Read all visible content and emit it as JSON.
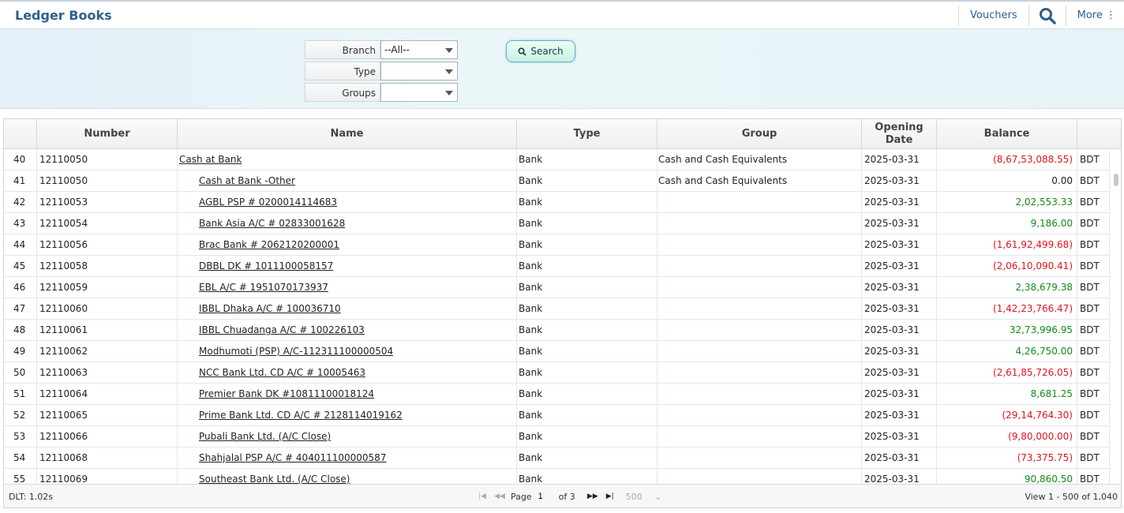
{
  "app": {
    "title": "Ledger Books"
  },
  "nav": {
    "vouchers": "Vouchers",
    "more": "More ⋮"
  },
  "filters": {
    "branch": {
      "label": "Branch",
      "value": "--All--"
    },
    "type": {
      "label": "Type",
      "value": ""
    },
    "groups": {
      "label": "Groups",
      "value": ""
    },
    "search_label": "Search"
  },
  "table": {
    "columns": {
      "number": "Number",
      "name": "Name",
      "type": "Type",
      "group": "Group",
      "opening_date": "Opening Date",
      "balance": "Balance"
    },
    "rows": [
      {
        "idx": "40",
        "number": "12110050",
        "name": "Cash at Bank",
        "indent": false,
        "type": "Bank",
        "group": "Cash and Cash Equivalents",
        "date": "2025-03-31",
        "balance": "(8,67,53,088.55)",
        "sign": "neg",
        "currency": "BDT"
      },
      {
        "idx": "41",
        "number": "12110050",
        "name": "Cash at Bank -Other",
        "indent": true,
        "type": "Bank",
        "group": "Cash and Cash Equivalents",
        "date": "2025-03-31",
        "balance": "0.00",
        "sign": "zero",
        "currency": "BDT"
      },
      {
        "idx": "42",
        "number": "12110053",
        "name": "AGBL PSP # 0200014114683",
        "indent": true,
        "type": "Bank",
        "group": "",
        "date": "2025-03-31",
        "balance": "2,02,553.33",
        "sign": "pos",
        "currency": "BDT"
      },
      {
        "idx": "43",
        "number": "12110054",
        "name": "Bank Asia A/C # 02833001628",
        "indent": true,
        "type": "Bank",
        "group": "",
        "date": "2025-03-31",
        "balance": "9,186.00",
        "sign": "pos",
        "currency": "BDT"
      },
      {
        "idx": "44",
        "number": "12110056",
        "name": "Brac Bank # 2062120200001",
        "indent": true,
        "type": "Bank",
        "group": "",
        "date": "2025-03-31",
        "balance": "(1,61,92,499.68)",
        "sign": "neg",
        "currency": "BDT"
      },
      {
        "idx": "45",
        "number": "12110058",
        "name": "DBBL DK # 1011100058157",
        "indent": true,
        "type": "Bank",
        "group": "",
        "date": "2025-03-31",
        "balance": "(2,06,10,090.41)",
        "sign": "neg",
        "currency": "BDT"
      },
      {
        "idx": "46",
        "number": "12110059",
        "name": "EBL A/C # 1951070173937",
        "indent": true,
        "type": "Bank",
        "group": "",
        "date": "2025-03-31",
        "balance": "2,38,679.38",
        "sign": "pos",
        "currency": "BDT"
      },
      {
        "idx": "47",
        "number": "12110060",
        "name": "IBBL Dhaka A/C # 100036710",
        "indent": true,
        "type": "Bank",
        "group": "",
        "date": "2025-03-31",
        "balance": "(1,42,23,766.47)",
        "sign": "neg",
        "currency": "BDT"
      },
      {
        "idx": "48",
        "number": "12110061",
        "name": "IBBL Chuadanga A/C # 100226103",
        "indent": true,
        "type": "Bank",
        "group": "",
        "date": "2025-03-31",
        "balance": "32,73,996.95",
        "sign": "pos",
        "currency": "BDT"
      },
      {
        "idx": "49",
        "number": "12110062",
        "name": "Modhumoti (PSP) A/C-112311100000504",
        "indent": true,
        "type": "Bank",
        "group": "",
        "date": "2025-03-31",
        "balance": "4,26,750.00",
        "sign": "pos",
        "currency": "BDT"
      },
      {
        "idx": "50",
        "number": "12110063",
        "name": "NCC Bank Ltd. CD A/C # 10005463",
        "indent": true,
        "type": "Bank",
        "group": "",
        "date": "2025-03-31",
        "balance": "(2,61,85,726.05)",
        "sign": "neg",
        "currency": "BDT"
      },
      {
        "idx": "51",
        "number": "12110064",
        "name": "Premier Bank DK #10811100018124",
        "indent": true,
        "type": "Bank",
        "group": "",
        "date": "2025-03-31",
        "balance": "8,681.25",
        "sign": "pos",
        "currency": "BDT"
      },
      {
        "idx": "52",
        "number": "12110065",
        "name": "Prime Bank Ltd. CD A/C # 2128114019162",
        "indent": true,
        "type": "Bank",
        "group": "",
        "date": "2025-03-31",
        "balance": "(29,14,764.30)",
        "sign": "neg",
        "currency": "BDT"
      },
      {
        "idx": "53",
        "number": "12110066",
        "name": "Pubali Bank Ltd. (A/C Close)",
        "indent": true,
        "type": "Bank",
        "group": "",
        "date": "2025-03-31",
        "balance": "(9,80,000.00)",
        "sign": "neg",
        "currency": "BDT"
      },
      {
        "idx": "54",
        "number": "12110068",
        "name": "Shahjalal PSP A/C # 404011100000587",
        "indent": true,
        "type": "Bank",
        "group": "",
        "date": "2025-03-31",
        "balance": "(73,375.75)",
        "sign": "neg",
        "currency": "BDT"
      },
      {
        "idx": "55",
        "number": "12110069",
        "name": "Southeast Bank Ltd. (A/C Close)",
        "indent": true,
        "type": "Bank",
        "group": "",
        "date": "2025-03-31",
        "balance": "90,860.50",
        "sign": "pos",
        "currency": "BDT"
      }
    ]
  },
  "pager": {
    "dlt": "DLT: 1.02s",
    "page_label": "Page",
    "page_value": "1",
    "of_pages": "of 3",
    "page_size": "500",
    "view_text": "View 1 - 500 of 1,040"
  },
  "colors": {
    "negative": "#e0141b",
    "positive": "#138a1a",
    "brand": "#2e5f8a"
  }
}
